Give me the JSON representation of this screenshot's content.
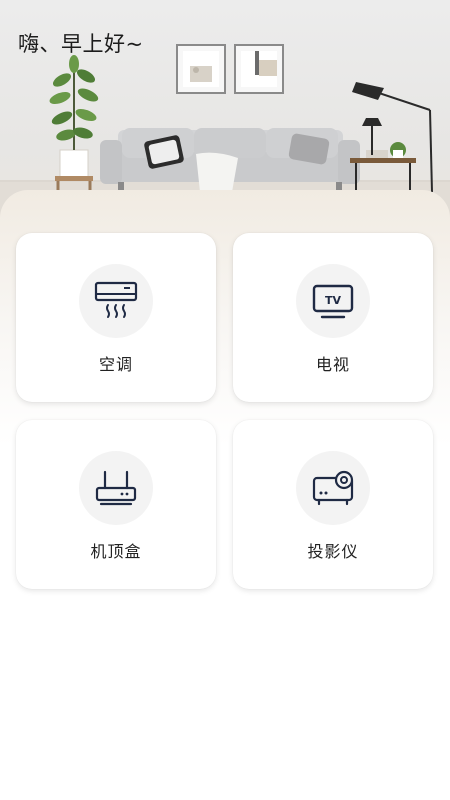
{
  "header": {
    "greeting": "嗨、早上好~"
  },
  "devices": [
    {
      "label": "空调",
      "icon": "air-conditioner-icon"
    },
    {
      "label": "电视",
      "icon": "tv-icon",
      "icon_text": "TV"
    },
    {
      "label": "机顶盒",
      "icon": "router-icon"
    },
    {
      "label": "投影仪",
      "icon": "projector-icon"
    }
  ],
  "colors": {
    "icon_stroke": "#1f2a44",
    "card_background": "#ffffff",
    "icon_circle": "#f3f3f3",
    "label_text": "#222222"
  }
}
